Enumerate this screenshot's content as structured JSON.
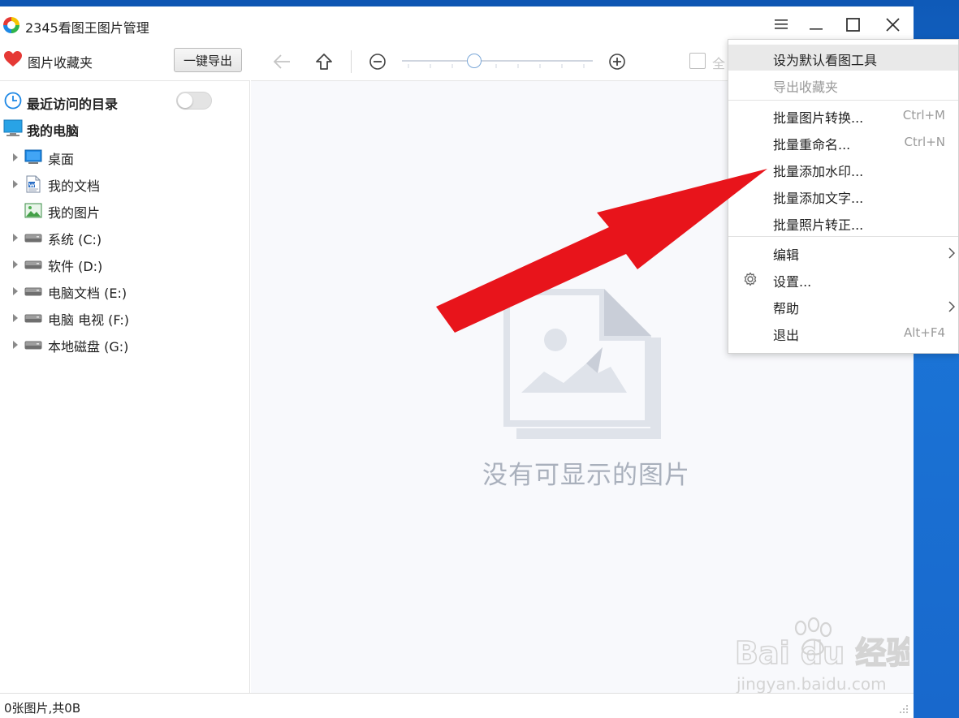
{
  "window": {
    "title": "2345看图王图片管理"
  },
  "toolbar": {
    "favorites_label": "图片收藏夹",
    "export_label": "一键导出",
    "select_all_label": "全",
    "zoom_level": 0.38
  },
  "sidebar": {
    "recent_label": "最近访问的目录",
    "recent_toggle_on": false,
    "computer_label": "我的电脑",
    "items": [
      {
        "label": "桌面",
        "icon": "desktop-icon"
      },
      {
        "label": "我的文档",
        "icon": "document-icon"
      },
      {
        "label": "我的图片",
        "icon": "pictures-icon"
      },
      {
        "label": "系统 (C:)",
        "icon": "drive-icon"
      },
      {
        "label": "软件 (D:)",
        "icon": "drive-icon"
      },
      {
        "label": "电脑文档 (E:)",
        "icon": "drive-icon"
      },
      {
        "label": "电脑 电视 (F:)",
        "icon": "drive-icon"
      },
      {
        "label": "本地磁盘 (G:)",
        "icon": "drive-icon"
      }
    ]
  },
  "main": {
    "empty_message": "没有可显示的图片"
  },
  "statusbar": {
    "text": "0张图片,共0B"
  },
  "menu": {
    "items": [
      {
        "label": "设为默认看图工具",
        "shortcut": ""
      },
      {
        "label": "导出收藏夹",
        "shortcut": ""
      },
      {
        "label": "批量图片转换...",
        "shortcut": "Ctrl+M"
      },
      {
        "label": "批量重命名...",
        "shortcut": "Ctrl+N"
      },
      {
        "label": "批量添加水印...",
        "shortcut": ""
      },
      {
        "label": "批量添加文字...",
        "shortcut": ""
      },
      {
        "label": "批量照片转正...",
        "shortcut": ""
      },
      {
        "label": "编辑",
        "shortcut": ""
      },
      {
        "label": "设置...",
        "shortcut": ""
      },
      {
        "label": "帮助",
        "shortcut": ""
      },
      {
        "label": "退出",
        "shortcut": "Alt+F4"
      }
    ]
  },
  "watermark": {
    "brand": "Bai du 经验",
    "url": "jingyan.baidu.com"
  },
  "colors": {
    "desktop": "#1565c8",
    "annotation_arrow": "#e8141b",
    "menu_highlight": "#e9e9e9",
    "empty_text": "#a9b0bc",
    "slider_thumb_border": "#7aa7d8"
  }
}
